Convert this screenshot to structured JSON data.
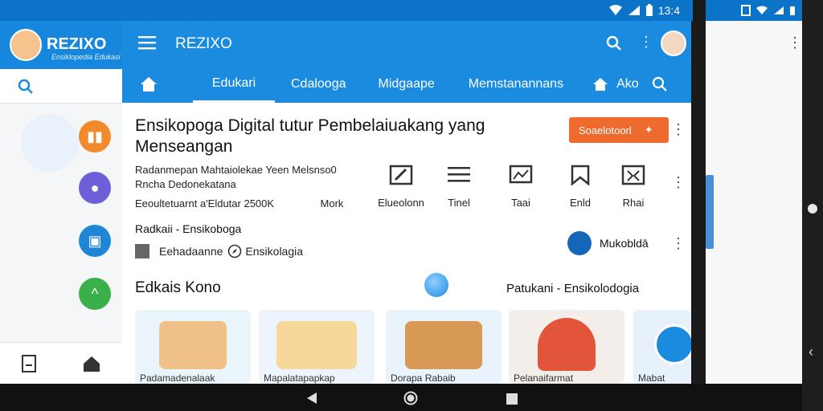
{
  "status": {
    "time": "13:4"
  },
  "left_app": {
    "logo_title": "REZIXO",
    "logo_sub": "Ensiklopedia Edukasi",
    "nav_icons": [
      "bookmark-icon",
      "home-icon"
    ]
  },
  "main": {
    "app_title": "REZIXO",
    "tabs": [
      {
        "label": "Edukari"
      },
      {
        "label": "Cdalooga"
      },
      {
        "label": "Midgaape"
      },
      {
        "label": "Memstanannans"
      },
      {
        "label": "Ako"
      }
    ],
    "heading": "Ensikopoga Digital tutur Pembelaiuakang yang Menseangan",
    "cta_label": "Soaelotoorl",
    "description_line1": "Radanmepan Mahtaiolekae Yeen Melsnso0",
    "description_line2": "Rncha Dedonekatana",
    "meta_line": "Eeoultetuarnt a'Eldutar 2500K",
    "actions": [
      {
        "label": "Mork"
      },
      {
        "label": "Elueolonn"
      },
      {
        "label": "Tinel"
      },
      {
        "label": "Taai"
      },
      {
        "label": "Enld"
      },
      {
        "label": "Rhai"
      }
    ],
    "source_title": "Radkaii - Ensikoboga",
    "source_a": "Eehadaanne",
    "source_b": "Ensikolagia",
    "channel_label": "Mukobldā",
    "section_left": "Edkais Kono",
    "section_right": "Patukani - Ensikolodogia",
    "cards": [
      {
        "caption": "Padamadenalaak"
      },
      {
        "caption": "Mapalatapapkap"
      },
      {
        "caption": "Dorapa Rabaib"
      },
      {
        "caption": "Pelanaifarmat"
      },
      {
        "caption": "Mabat"
      }
    ]
  },
  "colors": {
    "primary": "#1b8be0",
    "status": "#0b73c8",
    "accent": "#ef6a2d"
  }
}
